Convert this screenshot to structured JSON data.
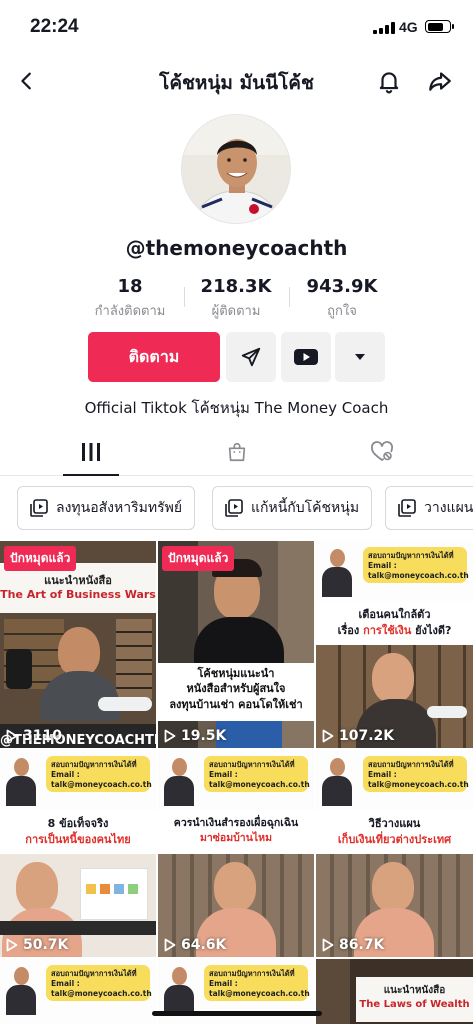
{
  "status_bar": {
    "time": "22:24",
    "network": "4G",
    "battery_level": 0.75
  },
  "nav": {
    "back_icon": "chevron-left-icon",
    "title": "โค้ชหนุ่ม มันนีโค้ช",
    "bell_icon": "bell-icon",
    "share_icon": "share-icon"
  },
  "profile": {
    "username": "@themoneycoachth",
    "stats": [
      {
        "value": "18",
        "label": "กำลังติดตาม"
      },
      {
        "value": "218.3K",
        "label": "ผู้ติดตาม"
      },
      {
        "value": "943.9K",
        "label": "ถูกใจ"
      }
    ],
    "follow_label": "ติดตาม",
    "bio": "Official Tiktok โค้ชหนุ่ม The Money Coach"
  },
  "tabs": [
    {
      "icon": "grid-icon",
      "active": true
    },
    {
      "icon": "shopping-bag-icon",
      "active": false
    },
    {
      "icon": "liked-heart-icon",
      "active": false
    }
  ],
  "playlists": [
    {
      "label": "ลงทุนอสังหาริมทรัพย์"
    },
    {
      "label": "แก้หนี้กับโค้ชหนุ่ม"
    },
    {
      "label": "วางแผน"
    }
  ],
  "colors": {
    "accent": "#ee2a55",
    "bubble": "#f7dd5b",
    "headline_red": "#e0302c"
  },
  "videos": [
    {
      "pinned": "ปักหมุดแล้ว",
      "title": "แนะนำหนังสือ",
      "subtitle": "The Art of Business Wars",
      "footer": "@THEMONEYCOACHTH",
      "views": "3110"
    },
    {
      "pinned": "ปักหมุดแล้ว",
      "caption": "โค้ชหนุ่มแนะนำ\nหนังสือสำหรับผู้สนใจ\nลงทุนบ้านเช่า คอนโดให้เช่า",
      "views": "19.5K"
    },
    {
      "bubble": "สอบถามปัญหาการเงินได้ที่\nEmail : talk@moneycoach.co.th",
      "line1": "เตือนคนใกล้ตัว",
      "line2a": "เรื่อง ",
      "line2b": "การใช้เงิน",
      "line2c": " ยังไงดี?",
      "views": "107.2K"
    },
    {
      "bubble": "สอบถามปัญหาการเงินได้ที่\nEmail : talk@moneycoach.co.th",
      "line1": "8 ข้อเท็จจริง",
      "line2b": "การเป็นหนี้ของคนไทย",
      "views": "50.7K"
    },
    {
      "bubble": "สอบถามปัญหาการเงินได้ที่\nEmail : talk@moneycoach.co.th",
      "line1": "ควรนำเงินสำรองเผื่อฉุกเฉิน",
      "line2b": "มาซ่อมบ้านไหม",
      "views": "64.6K"
    },
    {
      "bubble": "สอบถามปัญหาการเงินได้ที่\nEmail : talk@moneycoach.co.th",
      "line1": "วิธีวางแผน",
      "line2b": "เก็บเงินเที่ยวต่างประเทศ",
      "views": "86.7K"
    },
    {
      "bubble": "สอบถามปัญหาการเงินได้ที่\nEmail : talk@moneycoach.co.th"
    },
    {
      "bubble": "สอบถามปัญหาการเงินได้ที่\nEmail : talk@moneycoach.co.th"
    },
    {
      "title": "แนะนำหนังสือ",
      "subtitle": "The Laws of Wealth"
    }
  ]
}
